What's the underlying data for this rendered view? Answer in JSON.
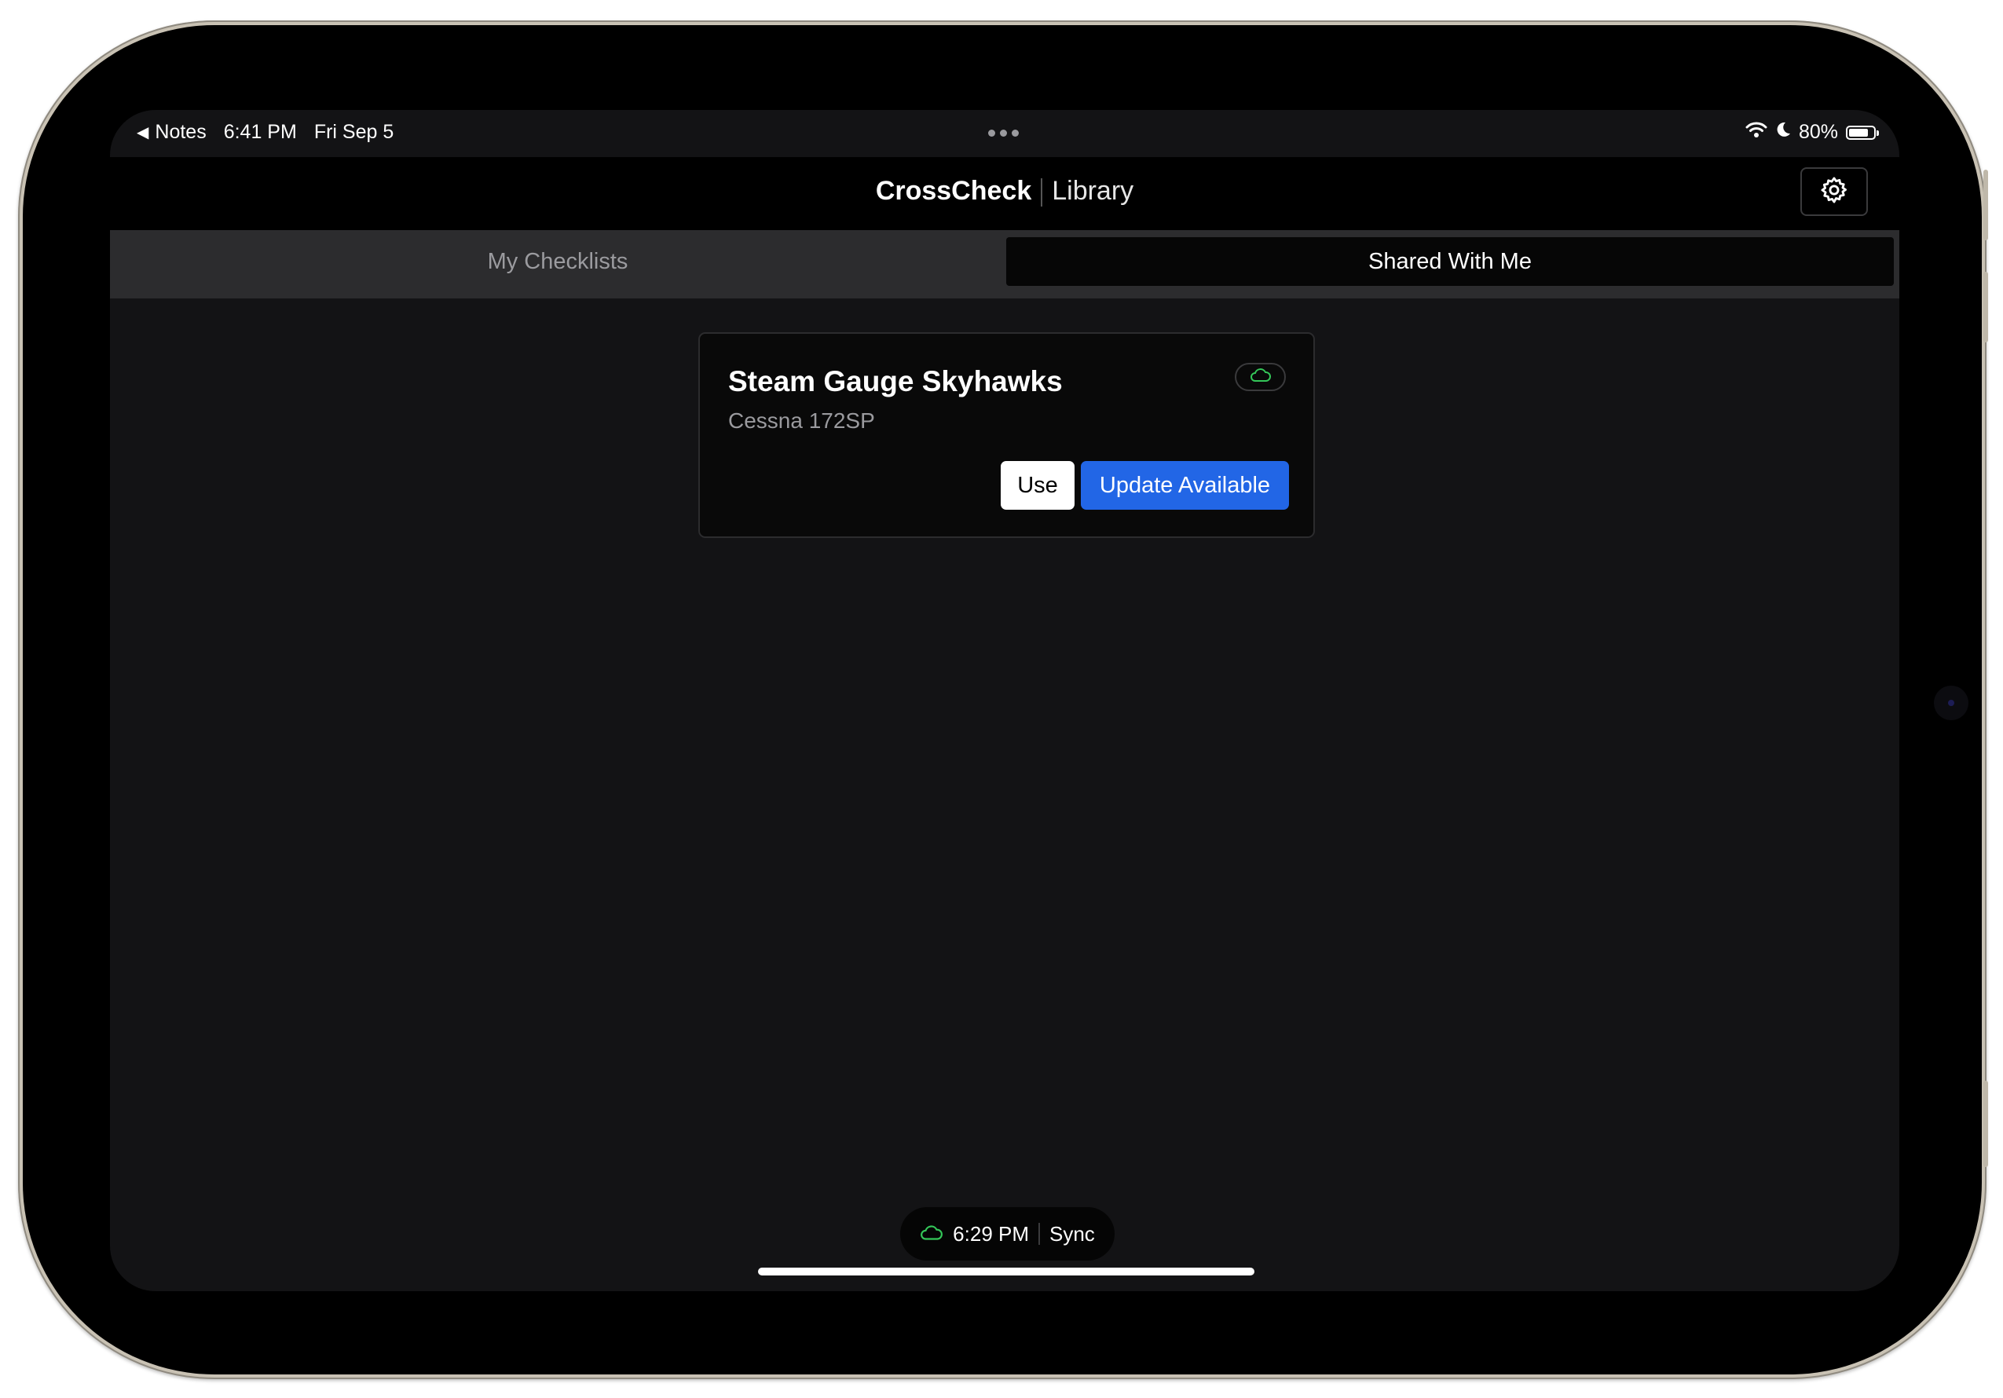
{
  "status_bar": {
    "back_app": "Notes",
    "time": "6:41 PM",
    "date": "Fri Sep 5",
    "battery": "80%",
    "battery_level": 0.8,
    "icons": [
      "wifi-icon",
      "moon-icon",
      "battery-icon"
    ]
  },
  "header": {
    "brand": "CrossCheck",
    "section": "Library",
    "settings_icon": "gear-icon"
  },
  "tabs": [
    {
      "label": "My Checklists",
      "selected": false
    },
    {
      "label": "Shared With Me",
      "selected": true
    }
  ],
  "checklist_card": {
    "title": "Steam Gauge Skyhawks",
    "aircraft": "Cessna 172SP",
    "badge_icon": "cloud-icon",
    "use_label": "Use",
    "update_label": "Update Available"
  },
  "sync_bar": {
    "time": "6:29 PM",
    "action": "Sync",
    "icon": "cloud-icon"
  },
  "colors": {
    "accent": "#2266e6",
    "cloud": "#34c759",
    "background": "#131315"
  }
}
